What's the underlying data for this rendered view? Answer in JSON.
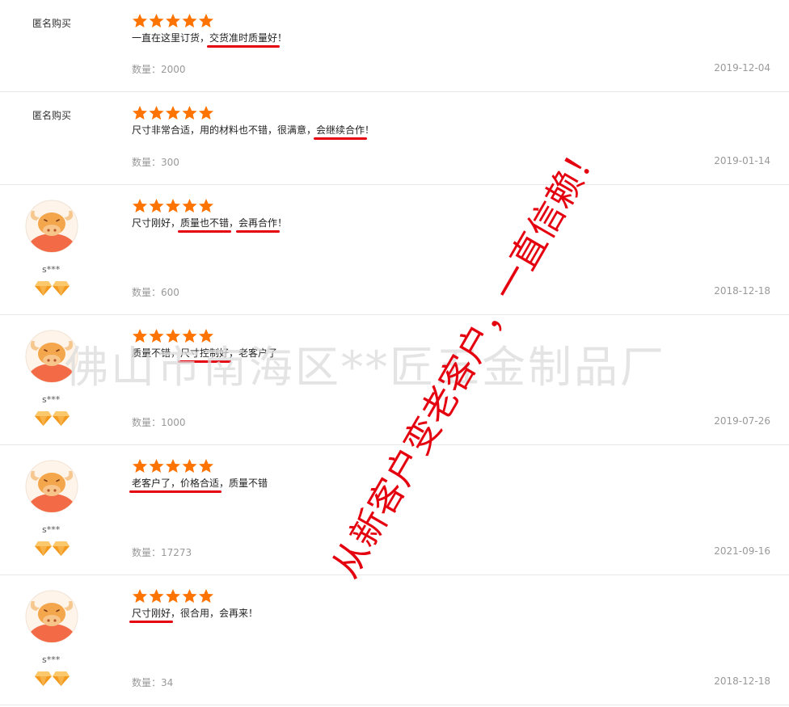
{
  "reviews": [
    {
      "anonymous": true,
      "buyer": "匿名购买",
      "rating": 5,
      "comment_parts": [
        {
          "text": "一直在这里订货，",
          "hl": false
        },
        {
          "text": "交货准时质量好",
          "hl": true
        },
        {
          "text": "！",
          "hl": false
        }
      ],
      "quantity": "数量：2000",
      "date": "2019-12-04"
    },
    {
      "anonymous": true,
      "buyer": "匿名购买",
      "rating": 5,
      "comment_parts": [
        {
          "text": "尺寸非常合适，用的材料也不错，很满意，",
          "hl": false
        },
        {
          "text": "会继续合作",
          "hl": true
        },
        {
          "text": "！",
          "hl": false
        }
      ],
      "quantity": "数量：300",
      "date": "2019-01-14"
    },
    {
      "anonymous": false,
      "nickname": "s***",
      "rating": 5,
      "comment_parts": [
        {
          "text": "尺寸刚好，",
          "hl": false
        },
        {
          "text": "质量也不错",
          "hl": true
        },
        {
          "text": "，",
          "hl": false
        },
        {
          "text": "会再合作",
          "hl": true
        },
        {
          "text": "！",
          "hl": false
        }
      ],
      "quantity": "数量：600",
      "date": "2018-12-18"
    },
    {
      "anonymous": false,
      "nickname": "s***",
      "rating": 5,
      "comment_parts": [
        {
          "text": "质量不错，",
          "hl": false
        },
        {
          "text": "尺寸控制好",
          "hl": true
        },
        {
          "text": "，老客户了",
          "hl": false
        }
      ],
      "quantity": "数量：1000",
      "date": "2019-07-26"
    },
    {
      "anonymous": false,
      "nickname": "s***",
      "rating": 5,
      "comment_parts": [
        {
          "text": "老客户了，价格合适",
          "hl": true
        },
        {
          "text": "，质量不错",
          "hl": false
        }
      ],
      "quantity": "数量：17273",
      "date": "2021-09-16"
    },
    {
      "anonymous": false,
      "nickname": "s***",
      "rating": 5,
      "comment_parts": [
        {
          "text": "尺寸刚好",
          "hl": true
        },
        {
          "text": "，很合用，会再来！",
          "hl": false
        }
      ],
      "quantity": "数量：34",
      "date": "2018-12-18"
    }
  ],
  "watermark": "佛山市南海区**匠五金制品厂",
  "slogan": "从新客户变老客户，一直信赖！",
  "icons": {
    "star": "star-icon",
    "avatar": "cow-avatar-icon",
    "badge": "diamond-icon"
  },
  "colors": {
    "star": "#ff7300",
    "highlight": "#e4000f",
    "meta": "#999999",
    "divider": "#e8e8e8"
  }
}
